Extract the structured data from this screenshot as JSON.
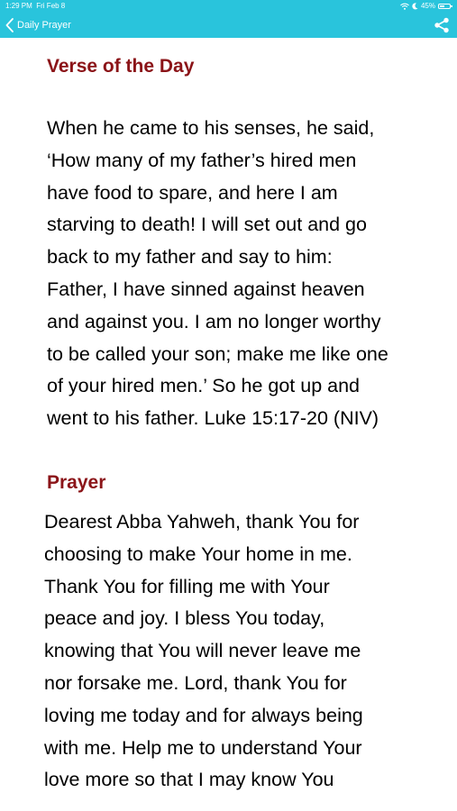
{
  "status_bar": {
    "time": "1:29 PM",
    "date": "Fri Feb 8",
    "battery_text": "45%",
    "battery_level": 0.45
  },
  "nav": {
    "title": "Daily Prayer",
    "back_icon": "chevron-left-icon",
    "share_icon": "share-icon"
  },
  "verse": {
    "heading": "Verse of the Day",
    "text": "When he came to his senses, he said,\n‘How many of my father’s hired men\nhave food to spare, and here I am\nstarving to death! I will set out and go\nback to my father and say to him:\nFather, I have sinned against heaven\nand against you. I am no longer worthy\nto be called your son; make me like one\nof your hired men.’ So he got up and\nwent to his father.  Luke 15:17-20 (NIV)"
  },
  "prayer": {
    "heading": "Prayer",
    "text": "Dearest Abba Yahweh, thank You for\nchoosing to make Your home in me.\nThank You for filling me with Your\npeace and joy. I bless You today,\nknowing that You will never leave me\nnor forsake me. Lord, thank You for\nloving me today and for always being\nwith me. Help me to understand Your\nlove more so that I may know You"
  },
  "colors": {
    "header_bg": "#29c4dc",
    "heading": "#8b1418",
    "body": "#000000"
  }
}
